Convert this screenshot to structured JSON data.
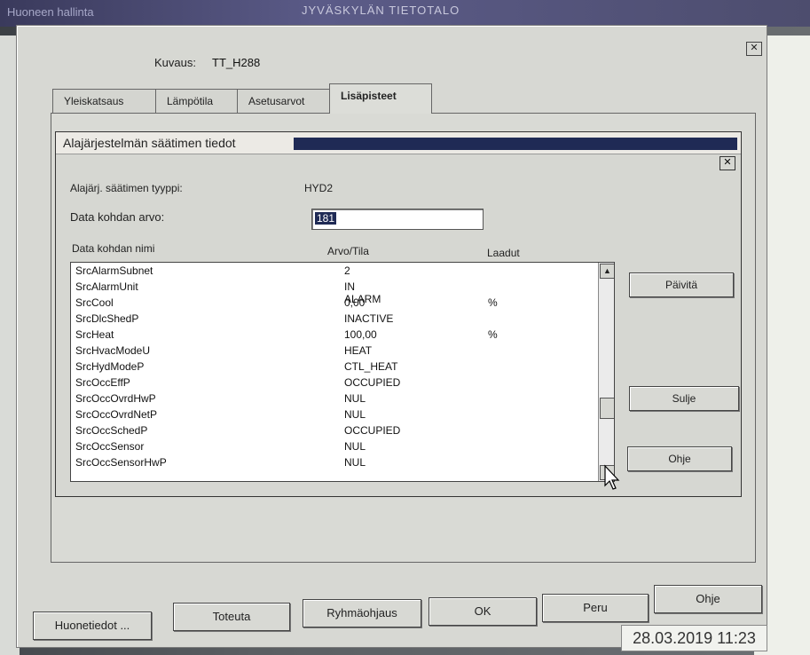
{
  "window": {
    "title": "Huoneen hallinta",
    "building": "JYVÄSKYLÄN TIETOTALO",
    "close_symbol": "✕"
  },
  "header": {
    "kuvaus_label": "Kuvaus:",
    "kuvaus_value": "TT_H288"
  },
  "tabs": [
    {
      "label": "Yleiskatsaus"
    },
    {
      "label": "Lämpötila"
    },
    {
      "label": "Asetusarvot"
    },
    {
      "label": "Lisäpisteet"
    }
  ],
  "dialog": {
    "title": "Alajärjestelmän säätimen tiedot",
    "close_symbol": "✕",
    "type_label": "Alajärj. säätimen tyyppi:",
    "type_value": "HYD2",
    "data_value_label": "Data kohdan arvo:",
    "data_value": "181",
    "columns": {
      "name": "Data kohdan nimi",
      "value": "Arvo/Tila",
      "quality": "Laadut"
    },
    "rows": [
      {
        "name": "SrcAlarmSubnet",
        "value": "2",
        "quality": ""
      },
      {
        "name": "SrcAlarmUnit",
        "value": "IN ALARM",
        "quality": ""
      },
      {
        "name": "SrcCool",
        "value": "0,00",
        "quality": "%"
      },
      {
        "name": "SrcDlcShedP",
        "value": "INACTIVE",
        "quality": ""
      },
      {
        "name": "SrcHeat",
        "value": "100,00",
        "quality": "%"
      },
      {
        "name": "SrcHvacModeU",
        "value": "HEAT",
        "quality": ""
      },
      {
        "name": "SrcHydModeP",
        "value": "CTL_HEAT",
        "quality": ""
      },
      {
        "name": "SrcOccEffP",
        "value": "OCCUPIED",
        "quality": ""
      },
      {
        "name": "SrcOccOvrdHwP",
        "value": "NUL",
        "quality": ""
      },
      {
        "name": "SrcOccOvrdNetP",
        "value": "NUL",
        "quality": ""
      },
      {
        "name": "SrcOccSchedP",
        "value": "OCCUPIED",
        "quality": ""
      },
      {
        "name": "SrcOccSensor",
        "value": "NUL",
        "quality": ""
      },
      {
        "name": "SrcOccSensorHwP",
        "value": "NUL",
        "quality": ""
      }
    ],
    "buttons": {
      "refresh": "Päivitä",
      "close": "Sulje",
      "help": "Ohje"
    },
    "scroll": {
      "up": "▲",
      "down": "▼"
    }
  },
  "footer": {
    "buttons": [
      {
        "label": "Huonetiedot ..."
      },
      {
        "label": "Toteuta"
      },
      {
        "label": "Ryhmäohjaus"
      },
      {
        "label": "OK"
      },
      {
        "label": "Peru"
      },
      {
        "label": "Ohje"
      }
    ],
    "datetime": "28.03.2019 11:23"
  }
}
